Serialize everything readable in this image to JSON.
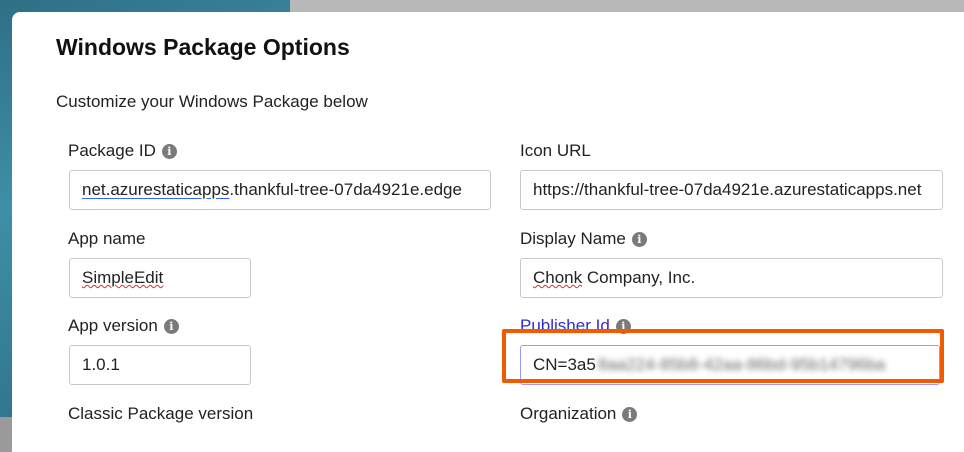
{
  "dialog": {
    "title": "Windows Package Options",
    "subtitle": "Customize your Windows Package below"
  },
  "fields": {
    "package_id": {
      "label": "Package ID",
      "value_prefix": "net.azurestaticapps",
      "value_rest": ".thankful-tree-07da4921e.edge"
    },
    "icon_url": {
      "label": "Icon URL",
      "value": "https://thankful-tree-07da4921e.azurestaticapps.net"
    },
    "app_name": {
      "label": "App name",
      "value": "SimpleEdit"
    },
    "display_name": {
      "label": "Display Name",
      "value_part1": "Chonk",
      "value_part2": " Company, Inc."
    },
    "app_version": {
      "label": "App version",
      "value": "1.0.1"
    },
    "publisher_id": {
      "label": "Publisher Id",
      "value_visible": "CN=3a5",
      "value_obscured": "8aa224-85b8-42aa-86bd-95b14796ba"
    },
    "classic_package_version": {
      "label": "Classic Package version"
    },
    "organization": {
      "label": "Organization"
    }
  },
  "icons": {
    "info": "info-icon"
  },
  "colors": {
    "accent": "#2c2ecc",
    "highlight": "#f05a00"
  }
}
